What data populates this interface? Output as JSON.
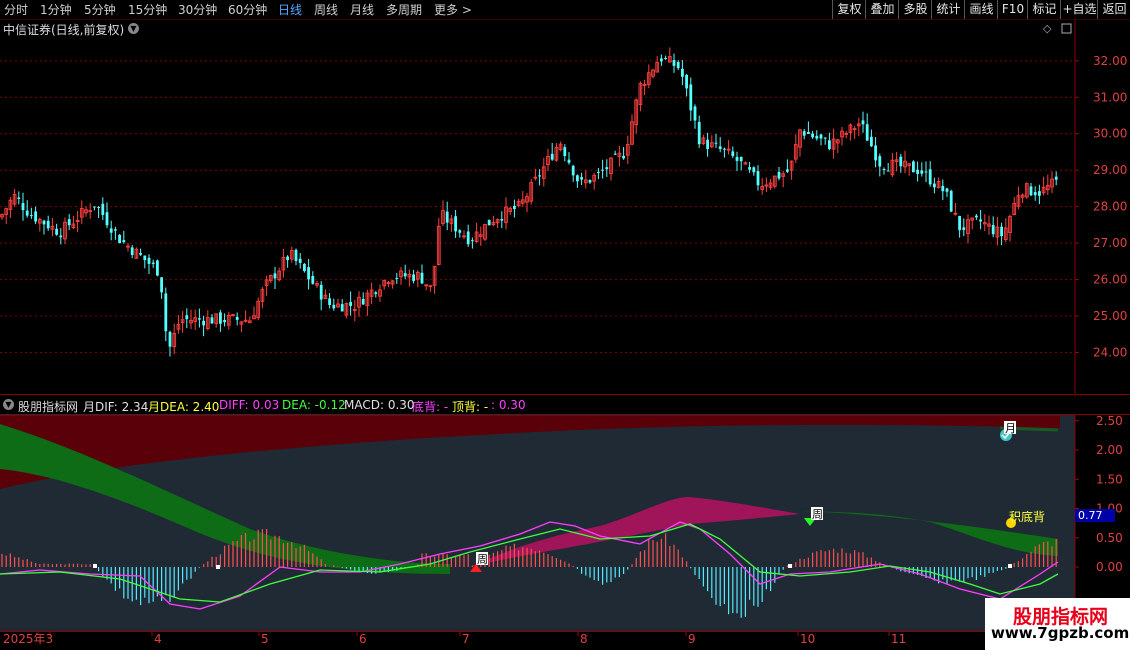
{
  "toolbar": {
    "periods": [
      "分时",
      "1分钟",
      "5分钟",
      "15分钟",
      "30分钟",
      "60分钟",
      "日线",
      "周线",
      "月线",
      "多周期",
      "更多 >"
    ],
    "active_period": "日线",
    "right_buttons": [
      "复权",
      "叠加",
      "多股",
      "统计",
      "画线",
      "F10",
      "标记",
      "+自选",
      "返回"
    ]
  },
  "chart": {
    "title": "中信证券(日线,前复权)",
    "price_axis": [
      "32.00",
      "31.00",
      "30.00",
      "29.00",
      "28.00",
      "27.00",
      "26.00",
      "25.00",
      "24.00"
    ],
    "price_range": [
      23.3,
      32.9
    ],
    "up_color": "#ff4040",
    "down_color": "#54ffff"
  },
  "indicator": {
    "name": "股朋指标网",
    "values": [
      {
        "text": "月DIF: 2.34",
        "color": "#e0e0e0"
      },
      {
        "text": "月DEA: 2.40",
        "color": "#ffff3c"
      },
      {
        "text": "DIFF: 0.03",
        "color": "#ff40ff"
      },
      {
        "text": "DEA: -0.12",
        "color": "#40ff40"
      },
      {
        "text": "MACD: 0.30",
        "color": "#e0e0e0"
      },
      {
        "text": "底背: -",
        "color": "#ff40ff"
      },
      {
        "text": "顶背: - ",
        "color": "#ffff3c"
      },
      {
        "text": ": 0.30",
        "color": "#ff40ff"
      }
    ],
    "axis": [
      "2.50",
      "2.00",
      "1.50",
      "1.00",
      "0.50",
      "0.00"
    ],
    "current_value": "0.77",
    "markers": [
      {
        "label": "周",
        "kind": "up-red",
        "series": "macd"
      },
      {
        "label": "周",
        "kind": "down-green",
        "series": "macd"
      },
      {
        "label": "月",
        "kind": "check",
        "series": "monthly"
      },
      {
        "label": "积底背",
        "kind": "yellow-dot",
        "series": "macd"
      }
    ]
  },
  "time_axis": {
    "labels": [
      "2025年3",
      "4",
      "5",
      "6",
      "7",
      "8",
      "9",
      "10",
      "11"
    ]
  },
  "brand": {
    "name": "股朋指标网",
    "url": "www.7gpzb.com"
  }
}
